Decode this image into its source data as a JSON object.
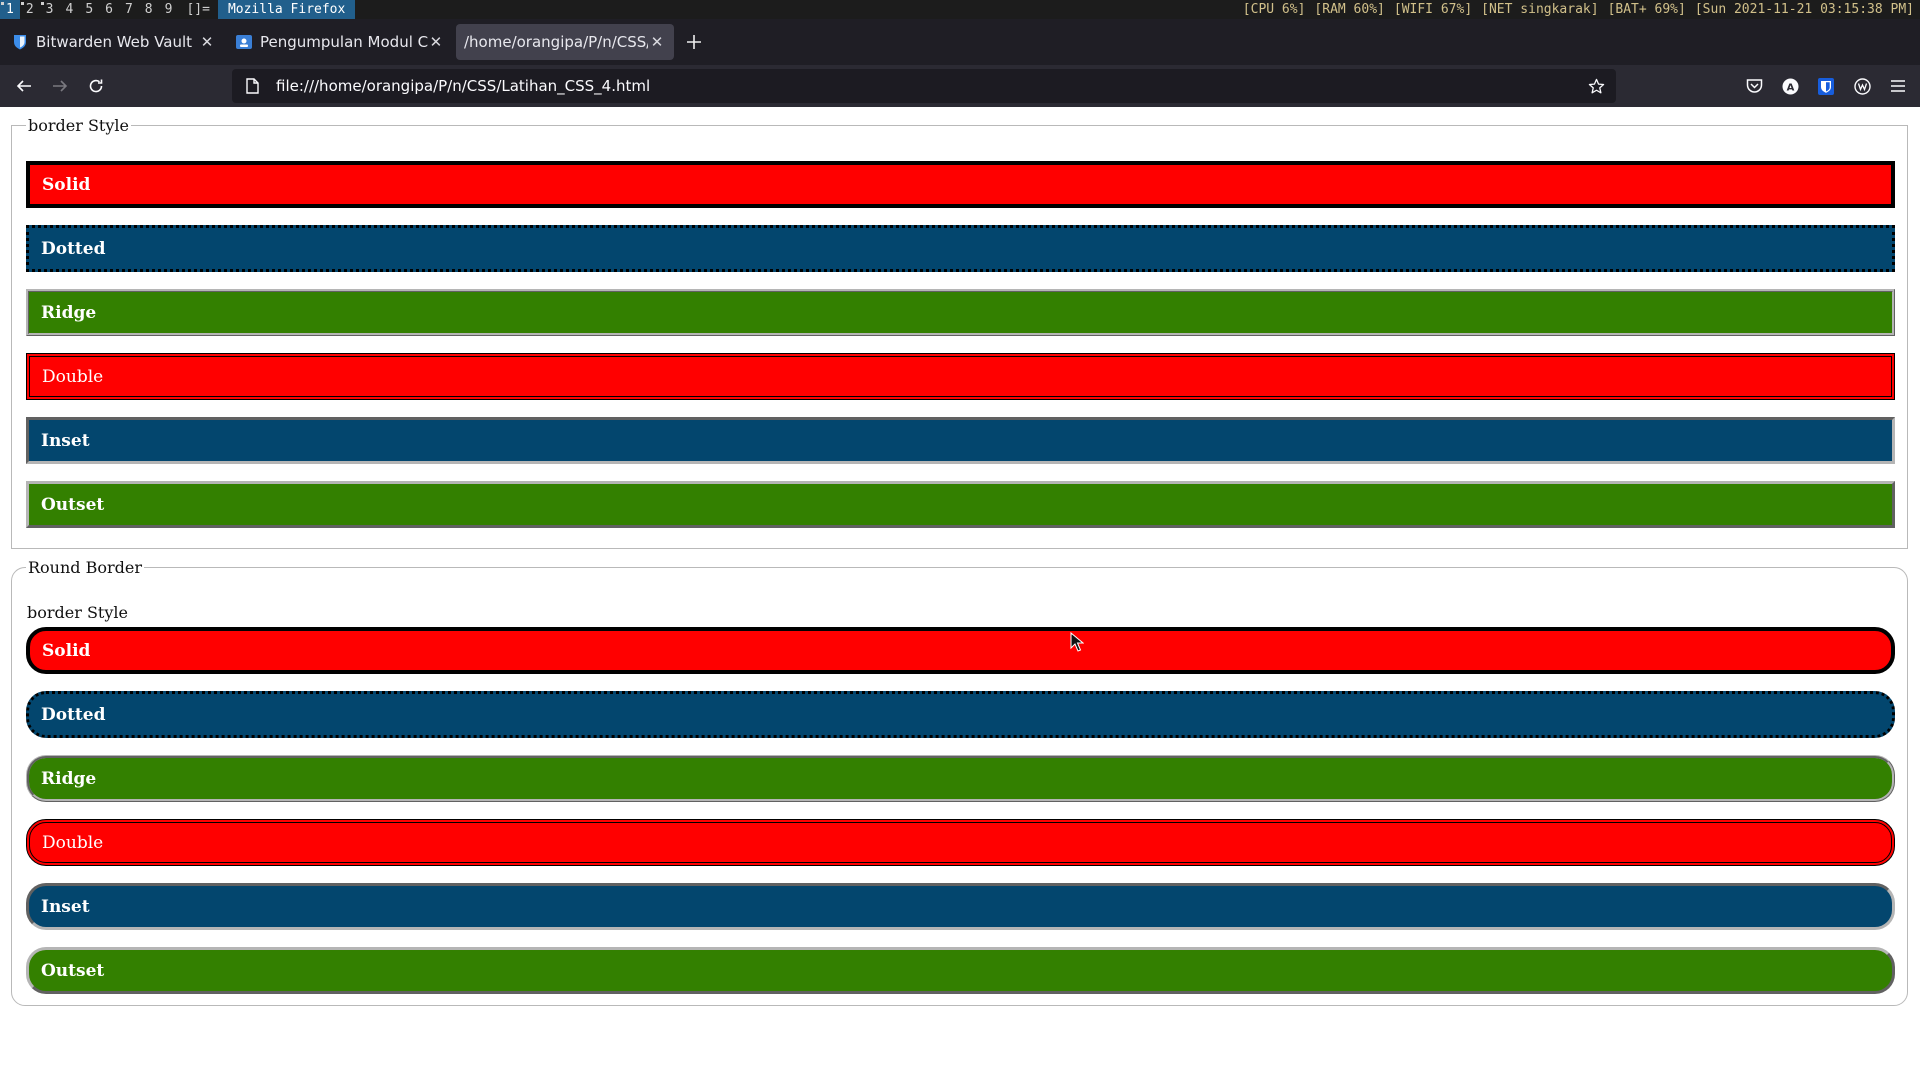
{
  "topbar": {
    "workspaces": [
      "1",
      "2",
      "3",
      "4",
      "5",
      "6",
      "7",
      "8",
      "9"
    ],
    "active_workspace": "1",
    "layout": "[]=",
    "window_title": "Mozilla Firefox",
    "status": {
      "cpu": "[CPU 6%]",
      "ram": "[RAM 60%]",
      "wifi": "[WIFI 67%]",
      "net": "[NET singkarak]",
      "bat": "[BAT+ 69%]",
      "clock": "[Sun 2021-11-21 03:15:38 PM]"
    }
  },
  "tabs": [
    {
      "label": "Bitwarden Web Vault",
      "icon": "bitwarden-shield-icon",
      "active": false
    },
    {
      "label": "Pengumpulan Modul CSS",
      "icon": "classroom-icon",
      "active": false
    },
    {
      "label": "/home/orangipa/P/n/CSS/Lat",
      "icon": "none",
      "active": true
    }
  ],
  "navbar": {
    "url": "file:///home/orangipa/P/n/CSS/Latihan_CSS_4.html"
  },
  "page": {
    "group1": {
      "legend": "border Style",
      "boxes": [
        {
          "label": "Solid",
          "color": "#ff0000",
          "style": "solid",
          "bold": true
        },
        {
          "label": "Dotted",
          "color": "#03466e",
          "style": "dotted",
          "bold": true
        },
        {
          "label": "Ridge",
          "color": "#338000",
          "style": "ridge",
          "bold": true
        },
        {
          "label": "Double",
          "color": "#ff0000",
          "style": "double",
          "bold": false
        },
        {
          "label": "Inset",
          "color": "#03466e",
          "style": "inset",
          "bold": true
        },
        {
          "label": "Outset",
          "color": "#338000",
          "style": "outset",
          "bold": true
        }
      ]
    },
    "group2": {
      "legend": "Round Border",
      "sublegend": "border Style",
      "boxes": [
        {
          "label": "Solid",
          "color": "#ff0000",
          "style": "solid",
          "bold": true
        },
        {
          "label": "Dotted",
          "color": "#03466e",
          "style": "dotted",
          "bold": true
        },
        {
          "label": "Ridge",
          "color": "#338000",
          "style": "ridge",
          "bold": true
        },
        {
          "label": "Double",
          "color": "#ff0000",
          "style": "double",
          "bold": false
        },
        {
          "label": "Inset",
          "color": "#03466e",
          "style": "inset",
          "bold": true
        },
        {
          "label": "Outset",
          "color": "#338000",
          "style": "outset",
          "bold": true
        }
      ]
    }
  }
}
